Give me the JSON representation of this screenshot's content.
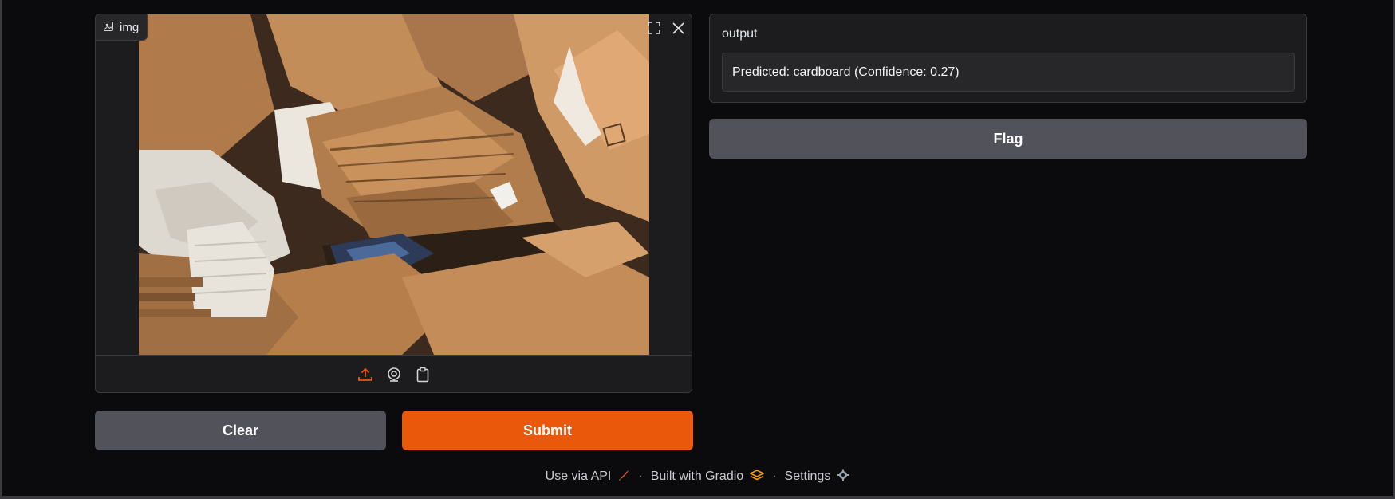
{
  "image_input": {
    "label": "img",
    "icons": {
      "label_icon": "image-icon",
      "fullscreen": "fullscreen-icon",
      "close": "close-icon",
      "upload": "upload-icon",
      "webcam": "webcam-icon",
      "clipboard": "clipboard-icon"
    }
  },
  "buttons": {
    "clear": "Clear",
    "submit": "Submit",
    "flag": "Flag"
  },
  "output": {
    "label": "output",
    "value": "Predicted: cardboard (Confidence: 0.27)"
  },
  "footer": {
    "api": "Use via API",
    "built_with": "Built with Gradio",
    "settings": "Settings",
    "separator": "·"
  },
  "colors": {
    "accent": "#ea580c",
    "button_secondary": "#52525b",
    "background": "#0b0b0d",
    "panel": "#1c1c1f"
  }
}
